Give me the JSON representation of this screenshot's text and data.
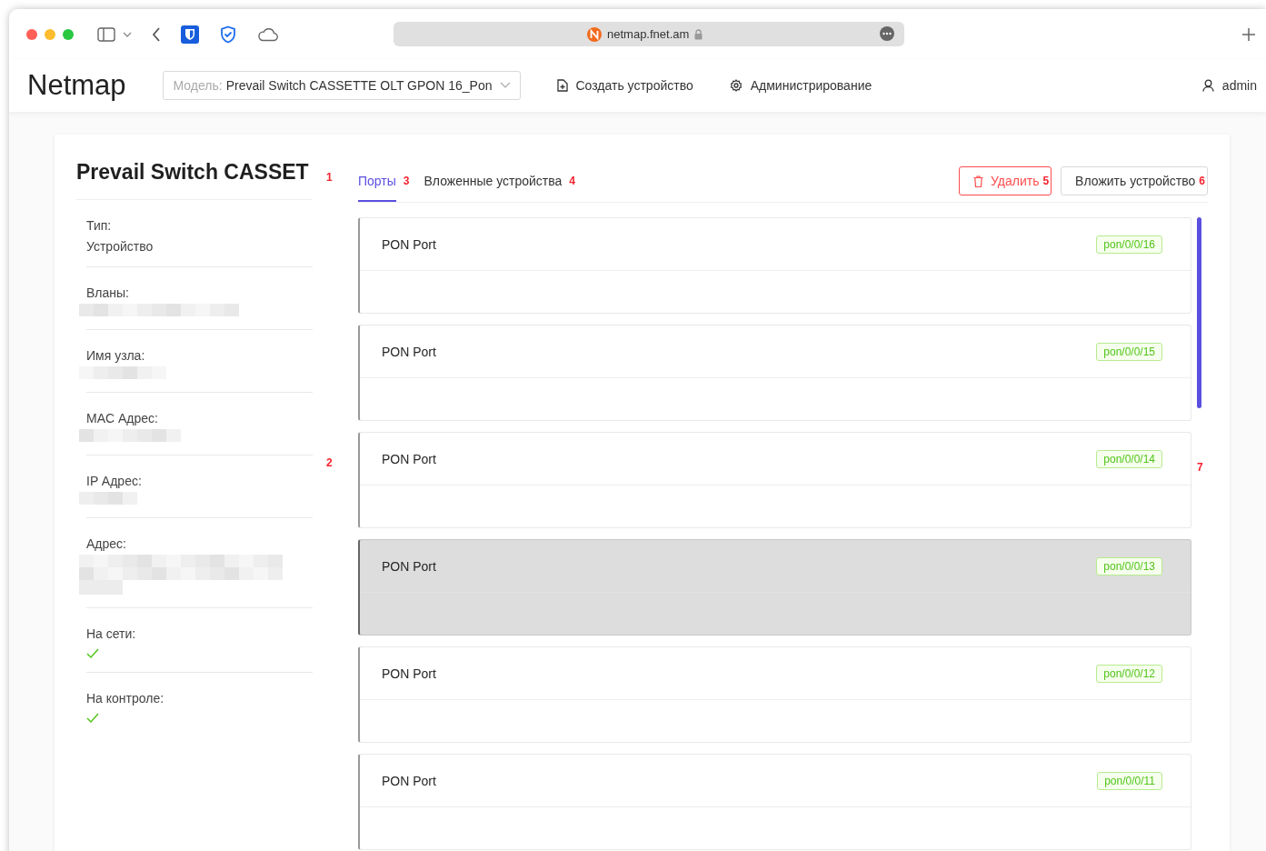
{
  "browser": {
    "url": "netmap.fnet.am"
  },
  "nav": {
    "logo": "Netmap",
    "model_label": "Модель:",
    "model_value": "Prevail Switch CASSETTE OLT GPON 16_Pon",
    "links": [
      {
        "label": "Создать устройство",
        "kind": "create"
      },
      {
        "label": "Администрирование",
        "kind": "admin"
      }
    ],
    "user": "admin"
  },
  "device": {
    "title": "Prevail Switch CASSET",
    "title_marker": "1",
    "side_marker": "2",
    "fields": [
      {
        "label": "Тип:",
        "kind": "text",
        "value": "Устройство"
      },
      {
        "label": "Вланы:",
        "kind": "blurred"
      },
      {
        "label": "Имя узла:",
        "kind": "blurred"
      },
      {
        "label": "MAC Адрес:",
        "kind": "blurred"
      },
      {
        "label": "IP Адрес:",
        "kind": "blurred"
      },
      {
        "label": "Адрес:",
        "kind": "blurred"
      },
      {
        "label": "На сети:",
        "kind": "check",
        "checked": true
      },
      {
        "label": "На контроле:",
        "kind": "check",
        "checked": true
      }
    ]
  },
  "tabs": [
    {
      "label": "Порты",
      "marker": "3",
      "selected": true
    },
    {
      "label": "Вложенные устройства",
      "marker": "4",
      "selected": false
    }
  ],
  "actions": [
    {
      "label": "Удалить",
      "marker": "5",
      "kind": "danger"
    },
    {
      "label": "Вложить устройство",
      "marker": "6",
      "kind": "default"
    }
  ],
  "list_marker": "7",
  "ports": [
    {
      "name": "PON Port",
      "tag": "pon/0/0/16",
      "highlighted": false
    },
    {
      "name": "PON Port",
      "tag": "pon/0/0/15",
      "highlighted": false
    },
    {
      "name": "PON Port",
      "tag": "pon/0/0/14",
      "highlighted": false
    },
    {
      "name": "PON Port",
      "tag": "pon/0/0/13",
      "highlighted": true
    },
    {
      "name": "PON Port",
      "tag": "pon/0/0/12",
      "highlighted": false
    },
    {
      "name": "PON Port",
      "tag": "pon/0/0/11",
      "highlighted": false
    }
  ]
}
